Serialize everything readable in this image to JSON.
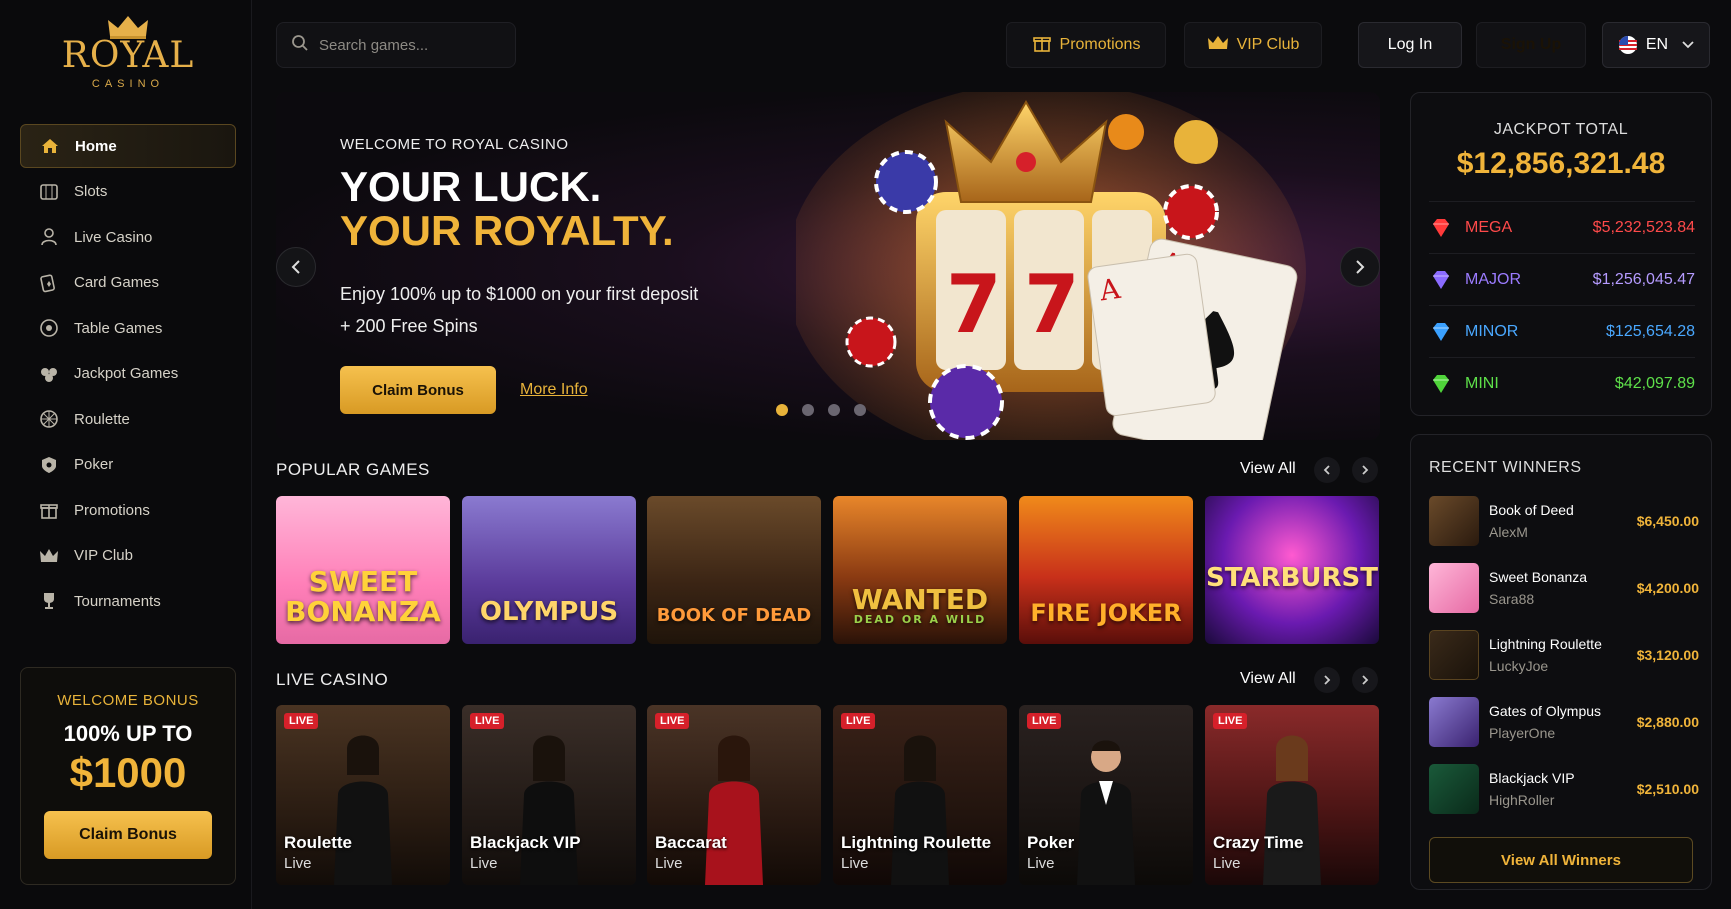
{
  "logo": {
    "brand": "ROYAL",
    "sub": "CASINO"
  },
  "sidebar": {
    "items": [
      {
        "label": "Home",
        "icon": "home-icon",
        "active": true
      },
      {
        "label": "Slots",
        "icon": "slots-icon"
      },
      {
        "label": "Live Casino",
        "icon": "live-casino-icon"
      },
      {
        "label": "Card Games",
        "icon": "card-games-icon"
      },
      {
        "label": "Table Games",
        "icon": "table-games-icon"
      },
      {
        "label": "Jackpot Games",
        "icon": "jackpot-icon"
      },
      {
        "label": "Roulette",
        "icon": "roulette-icon"
      },
      {
        "label": "Poker",
        "icon": "poker-icon"
      },
      {
        "label": "Promotions",
        "icon": "gift-icon"
      },
      {
        "label": "VIP Club",
        "icon": "crown-icon"
      },
      {
        "label": "Tournaments",
        "icon": "trophy-icon"
      }
    ],
    "bonus": {
      "title": "WELCOME BONUS",
      "line1": "100% UP TO",
      "amount": "$1000",
      "button": "Claim Bonus"
    }
  },
  "header": {
    "search_placeholder": "Search games...",
    "promotions": "Promotions",
    "vip": "VIP Club",
    "login": "Log In",
    "signup": "Sign Up",
    "lang": "EN"
  },
  "hero": {
    "eyebrow": "WELCOME TO ROYAL CASINO",
    "line1": "YOUR LUCK.",
    "line2": "YOUR ROYALTY.",
    "desc1": "Enjoy 100% up to $1000 on your first deposit",
    "desc2": "+ 200 Free Spins",
    "cta": "Claim Bonus",
    "more": "More Info",
    "slide_count": 4,
    "active_slide": 1
  },
  "jackpot": {
    "label": "JACKPOT TOTAL",
    "total": "$12,856,321.48",
    "tiers": [
      {
        "name": "MEGA",
        "value": "$5,232,523.84",
        "color": "#ff4a4a"
      },
      {
        "name": "MAJOR",
        "value": "$1,256,045.47",
        "color": "#9b7bff"
      },
      {
        "name": "MINOR",
        "value": "$125,654.28",
        "color": "#4aa8ff"
      },
      {
        "name": "MINI",
        "value": "$42,097.89",
        "color": "#5ee04a"
      }
    ]
  },
  "popular": {
    "title": "POPULAR GAMES",
    "view_all": "View All",
    "games": [
      {
        "title": "SWEET BONANZA"
      },
      {
        "title": "OLYMPUS"
      },
      {
        "title": "BOOK OF DEAD"
      },
      {
        "title": "WANTED",
        "subtitle": "DEAD OR A WILD"
      },
      {
        "title": "FIRE JOKER"
      },
      {
        "title": "STARBURST"
      }
    ]
  },
  "live": {
    "title": "LIVE CASINO",
    "view_all": "View All",
    "badge": "LIVE",
    "games": [
      {
        "name": "Roulette",
        "status": "Live"
      },
      {
        "name": "Blackjack VIP",
        "status": "Live"
      },
      {
        "name": "Baccarat",
        "status": "Live"
      },
      {
        "name": "Lightning Roulette",
        "status": "Live"
      },
      {
        "name": "Poker",
        "status": "Live"
      },
      {
        "name": "Crazy Time",
        "status": "Live"
      }
    ]
  },
  "winners": {
    "title": "RECENT WINNERS",
    "list": [
      {
        "game": "Book of Deed",
        "user": "AlexM",
        "amount": "$6,450.00"
      },
      {
        "game": "Sweet Bonanza",
        "user": "Sara88",
        "amount": "$4,200.00"
      },
      {
        "game": "Lightning Roulette",
        "user": "LuckyJoe",
        "amount": "$3,120.00"
      },
      {
        "game": "Gates of Olympus",
        "user": "PlayerOne",
        "amount": "$2,880.00"
      },
      {
        "game": "Blackjack VIP",
        "user": "HighRoller",
        "amount": "$2,510.00"
      }
    ],
    "view_all": "View All Winners"
  }
}
